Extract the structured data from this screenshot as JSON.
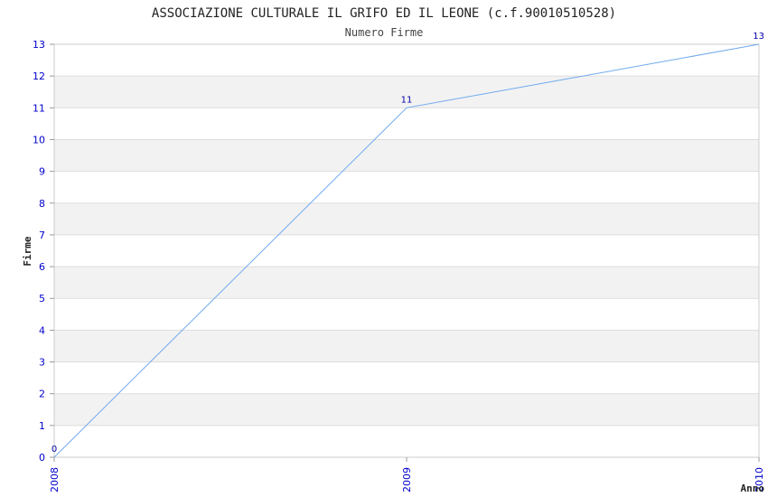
{
  "chart_data": {
    "type": "line",
    "title": "ASSOCIAZIONE CULTURALE IL GRIFO ED IL LEONE (c.f.90010510528)",
    "subtitle": "Numero Firme",
    "xlabel": "Anno",
    "ylabel": "Firme",
    "categories": [
      "2008",
      "2009",
      "2010"
    ],
    "values": [
      0,
      11,
      13
    ],
    "data_labels": [
      "0",
      "11",
      "13"
    ],
    "ylim": [
      0,
      13
    ],
    "yticks": [
      0,
      1,
      2,
      3,
      4,
      5,
      6,
      7,
      8,
      9,
      10,
      11,
      12,
      13
    ],
    "grid": true,
    "band_color": "#f2f2f2",
    "grid_color": "#dddddd",
    "line_color": "#70aaee",
    "tick_color": "#0000cc"
  }
}
